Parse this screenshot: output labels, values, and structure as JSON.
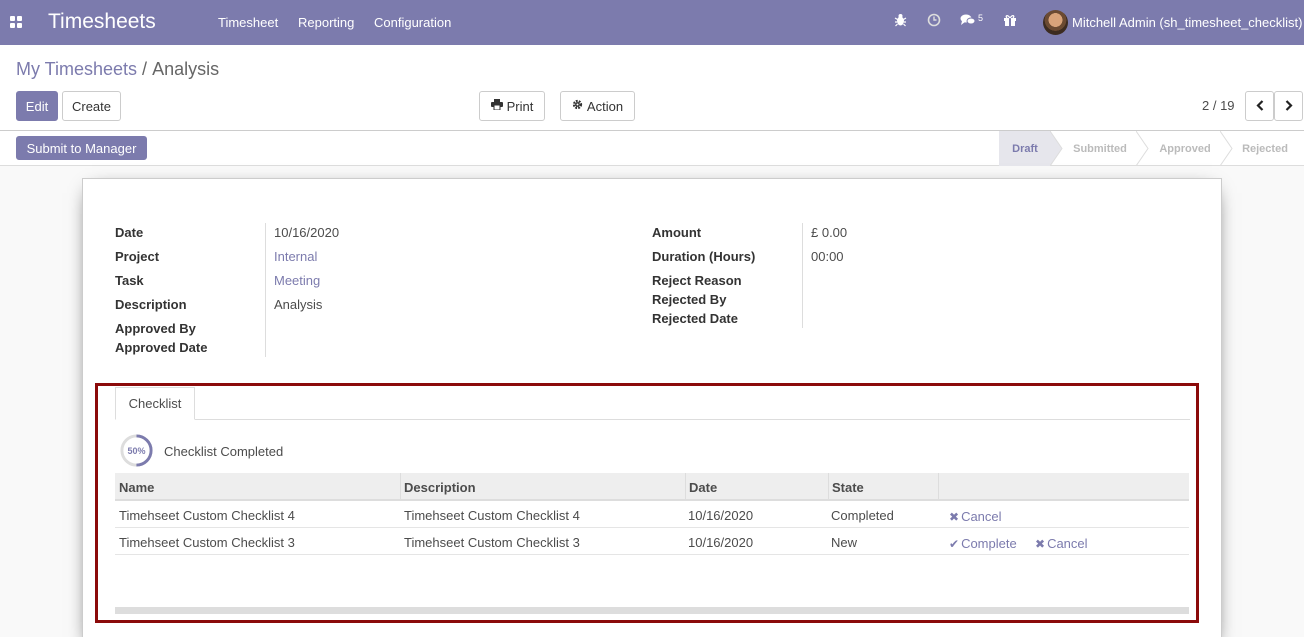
{
  "navbar": {
    "brand": "Timesheets",
    "menu": [
      "Timesheet",
      "Reporting",
      "Configuration"
    ],
    "messages_count": "5",
    "user": "Mitchell Admin (sh_timesheet_checklist)"
  },
  "breadcrumb": {
    "parent": "My Timesheets",
    "separator": "/",
    "current": "Analysis"
  },
  "buttons": {
    "edit": "Edit",
    "create": "Create",
    "print": "Print",
    "action": "Action",
    "submit": "Submit to Manager"
  },
  "pager": {
    "value": "2 / 19"
  },
  "statusbar": {
    "stages": [
      "Draft",
      "Submitted",
      "Approved",
      "Rejected"
    ],
    "active": "Draft"
  },
  "form": {
    "left": [
      {
        "label": "Date",
        "value": "10/16/2020",
        "link": false
      },
      {
        "label": "Project",
        "value": "Internal",
        "link": true
      },
      {
        "label": "Task",
        "value": "Meeting",
        "link": true
      },
      {
        "label": "Description",
        "value": "Analysis",
        "link": false
      },
      {
        "label": "Approved By",
        "value": "",
        "link": false
      },
      {
        "label": "Approved Date",
        "value": "",
        "link": false
      }
    ],
    "right": [
      {
        "label": "Amount",
        "value": "£ 0.00"
      },
      {
        "label": "Duration (Hours)",
        "value": "00:00"
      },
      {
        "label": "Reject Reason",
        "value": ""
      },
      {
        "label": "Rejected By",
        "value": ""
      },
      {
        "label": "Rejected Date",
        "value": ""
      }
    ]
  },
  "notebook": {
    "tab": "Checklist",
    "progress_percent": 50,
    "progress_text": "50%",
    "progress_label": "Checklist Completed",
    "columns": [
      "Name",
      "Description",
      "Date",
      "State"
    ],
    "rows": [
      {
        "name": "Timehseet Custom Checklist 4",
        "description": "Timehseet Custom Checklist 4",
        "date": "10/16/2020",
        "state": "Completed",
        "complete": "",
        "cancel": "Cancel"
      },
      {
        "name": "Timehseet Custom Checklist 3",
        "description": "Timehseet Custom Checklist 3",
        "date": "10/16/2020",
        "state": "New",
        "complete": "Complete",
        "cancel": "Cancel"
      }
    ]
  },
  "colors": {
    "brand": "#7c7bad",
    "highlight": "#8b0a0a"
  }
}
